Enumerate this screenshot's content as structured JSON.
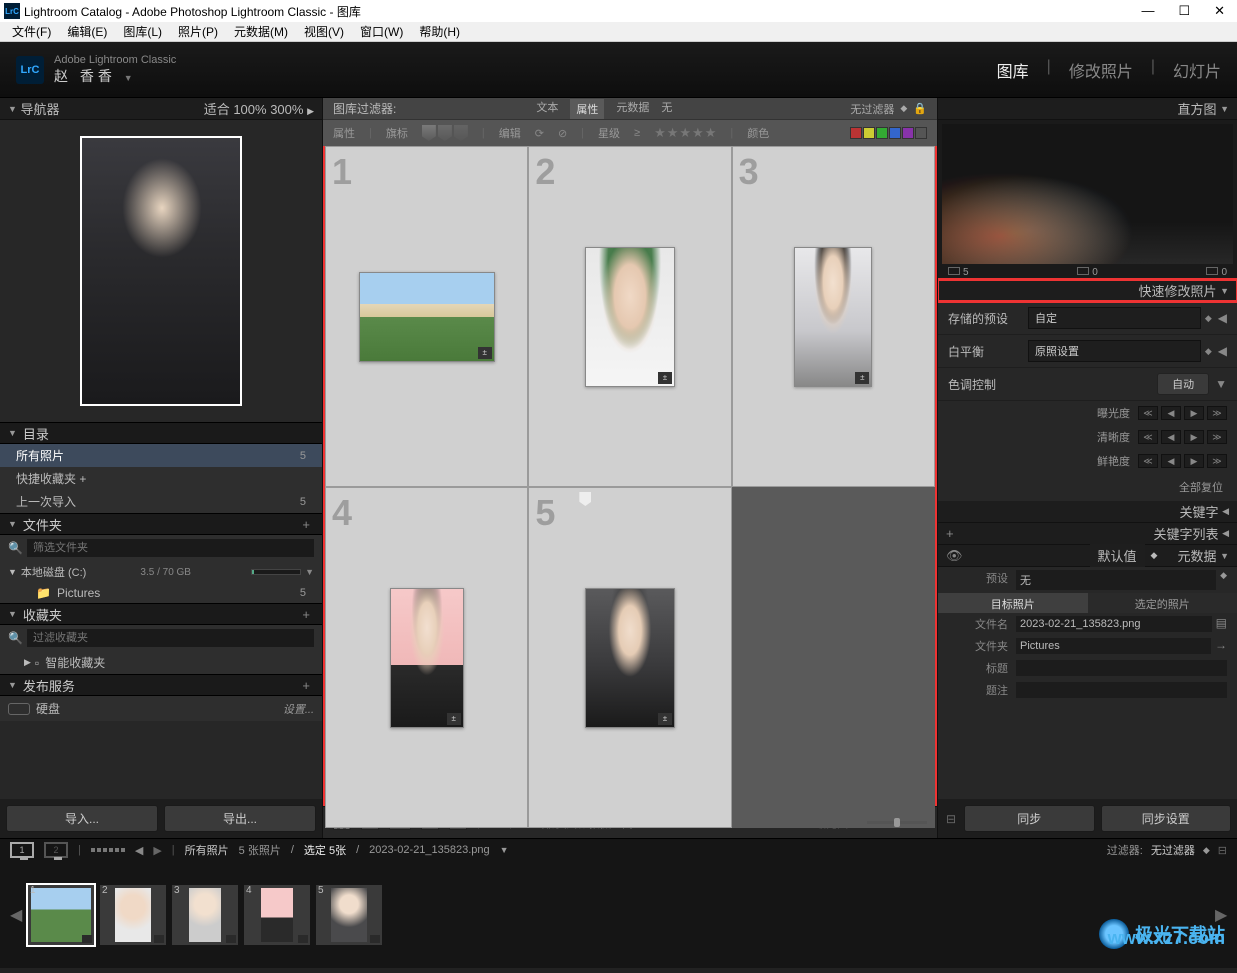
{
  "titlebar": {
    "title": "Lightroom Catalog - Adobe Photoshop Lightroom Classic - 图库"
  },
  "menu": {
    "items": [
      "文件(F)",
      "编辑(E)",
      "图库(L)",
      "照片(P)",
      "元数据(M)",
      "视图(V)",
      "窗口(W)",
      "帮助(H)"
    ]
  },
  "identity": {
    "app": "Adobe Lightroom Classic",
    "name": "赵 香香"
  },
  "modules": {
    "items": [
      "图库",
      "修改照片",
      "幻灯片"
    ],
    "active": 0
  },
  "navigator": {
    "title": "导航器",
    "zoom": [
      "适合",
      "100%",
      "300%"
    ]
  },
  "catalog": {
    "title": "目录",
    "rows": [
      {
        "label": "所有照片",
        "count": "5"
      },
      {
        "label": "快捷收藏夹 +",
        "count": ""
      },
      {
        "label": "上一次导入",
        "count": "5"
      }
    ]
  },
  "folders": {
    "title": "文件夹",
    "filter_placeholder": "筛选文件夹",
    "disk": {
      "label": "本地磁盘 (C:)",
      "size": "3.5 / 70 GB"
    },
    "sub": {
      "label": "Pictures",
      "count": "5"
    }
  },
  "collections": {
    "title": "收藏夹",
    "filter_placeholder": "过滤收藏夹",
    "smart": "智能收藏夹"
  },
  "publish": {
    "title": "发布服务",
    "hd": "硬盘",
    "setup": "设置..."
  },
  "bottom_buttons": {
    "import": "导入...",
    "export": "导出..."
  },
  "filter_bar": {
    "label": "图库过滤器:",
    "tabs": [
      "文本",
      "属性",
      "元数据",
      "无"
    ],
    "nofilter": "无过滤器"
  },
  "attr_filter": {
    "attribute": "属性",
    "flag": "旗标",
    "edit": "编辑",
    "rating": "星级",
    "color": "颜色"
  },
  "grid": {
    "cells": [
      "1",
      "2",
      "3",
      "4",
      "5"
    ]
  },
  "center_toolbar": {
    "sort_by": "排序依据",
    "sort_value": "拍摄时间",
    "thumb_label": "缩览图"
  },
  "histogram": {
    "title": "直方图",
    "iso": "5",
    "values": [
      "0",
      "0"
    ]
  },
  "quick_dev": {
    "title": "快速修改照片",
    "preset_label": "存储的预设",
    "preset_value": "自定",
    "wb_label": "白平衡",
    "wb_value": "原照设置",
    "tone_label": "色调控制",
    "tone_btn": "自动",
    "exposure": "曝光度",
    "clarity": "清晰度",
    "vibrance": "鲜艳度",
    "reset": "全部复位"
  },
  "keywords": {
    "title": "关键字"
  },
  "keyword_list": {
    "title": "关键字列表"
  },
  "metadata": {
    "title": "元数据",
    "dropdown": "默认值",
    "preset_label": "预设",
    "preset_value": "无",
    "tabs": [
      "目标照片",
      "选定的照片"
    ],
    "filename_label": "文件名",
    "filename_value": "2023-02-21_135823.png",
    "folder_label": "文件夹",
    "folder_value": "Pictures",
    "title_label": "标题",
    "caption_label": "题注"
  },
  "sync": {
    "sync": "同步",
    "sync_settings": "同步设置"
  },
  "filmstrip": {
    "source": "所有照片",
    "count": "5 张照片",
    "selected": "选定 5张",
    "filename": "2023-02-21_135823.png",
    "filter_label": "过滤器:",
    "filter_value": "无过滤器"
  },
  "watermark": {
    "text": "极光下载站",
    "url": "www.xz7.com"
  }
}
